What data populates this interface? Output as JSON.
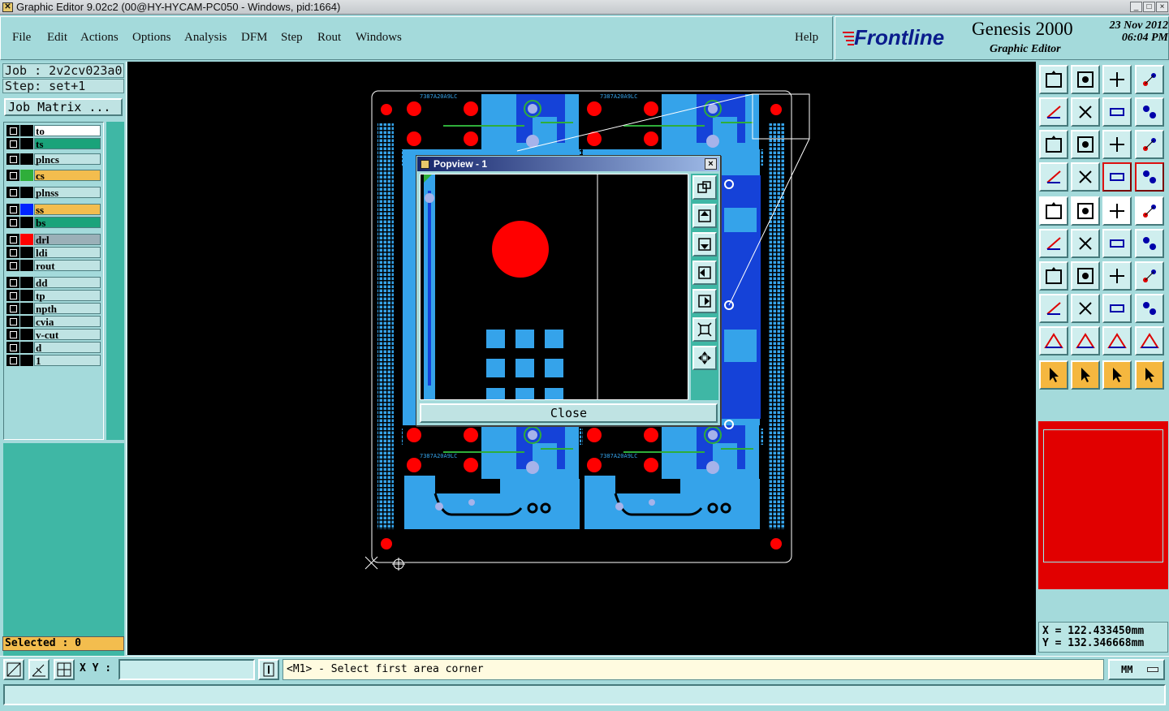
{
  "window": {
    "title": "Graphic Editor 9.02c2 (00@HY-HYCAM-PC050 - Windows, pid:1664)",
    "controls": [
      "_",
      "□",
      "×"
    ]
  },
  "menu": [
    {
      "label": "File"
    },
    {
      "label": "Edit"
    },
    {
      "label": "Actions"
    },
    {
      "label": "Options"
    },
    {
      "label": "Analysis"
    },
    {
      "label": "DFM"
    },
    {
      "label": "Step"
    },
    {
      "label": "Rout"
    },
    {
      "label": "Windows"
    },
    {
      "label": "Help"
    }
  ],
  "brand": {
    "logo": "Frontline",
    "product": "Genesis 2000",
    "subtitle": "Graphic Editor",
    "date": "23 Nov 2012",
    "time": "06:04 PM"
  },
  "job": {
    "job_line": "Job : 2v2cv023a0",
    "step_line": "Step: set+1",
    "matrix_button": "Job Matrix ..."
  },
  "layers": [
    {
      "name": "to",
      "color": "",
      "bg": "#ffffff"
    },
    {
      "name": "ts",
      "color": "",
      "bg": "#1aa37a"
    },
    {
      "name": "plncs",
      "color": "",
      "bg": "#bfe3e3"
    },
    {
      "name": "cs",
      "color": "#2fae3a",
      "bg": "#f3bd4e"
    },
    {
      "name": "plnss",
      "color": "",
      "bg": "#bfe3e3"
    },
    {
      "name": "ss",
      "color": "#0024ff",
      "bg": "#f3bd4e"
    },
    {
      "name": "bs",
      "color": "",
      "bg": "#1aa37a"
    },
    {
      "name": "drl",
      "color": "#ff0000",
      "bg": "#9bb0b8"
    },
    {
      "name": "ldi",
      "color": "",
      "bg": "#bfe3e3"
    },
    {
      "name": "rout",
      "color": "",
      "bg": "#bfe3e3"
    },
    {
      "name": "dd",
      "color": "",
      "bg": "#bfe3e3"
    },
    {
      "name": "tp",
      "color": "",
      "bg": "#bfe3e3"
    },
    {
      "name": "npth",
      "color": "",
      "bg": "#bfe3e3"
    },
    {
      "name": "cvia",
      "color": "",
      "bg": "#bfe3e3"
    },
    {
      "name": "v-cut",
      "color": "",
      "bg": "#bfe3e3"
    },
    {
      "name": "d",
      "color": "",
      "bg": "#bfe3e3"
    },
    {
      "name": "1",
      "color": "",
      "bg": "#bfe3e3"
    }
  ],
  "selected": "Selected : 0",
  "board_label": "7387A20A9LC",
  "popview": {
    "title": "Popview - 1",
    "close_label": "Close"
  },
  "coords": {
    "x": "X = 122.433450mm",
    "y": "Y = 132.346668mm"
  },
  "bottom": {
    "xy_label": "X Y :",
    "xy_value": "",
    "prompt": "<M1> - Select first area corner",
    "units": "MM"
  },
  "colors": {
    "copper": "#35a3ea",
    "copper_dark": "#1542d8",
    "drill": "#ff0000",
    "panel_bg": "#a4dadb",
    "canvas_bg": "#000000"
  }
}
